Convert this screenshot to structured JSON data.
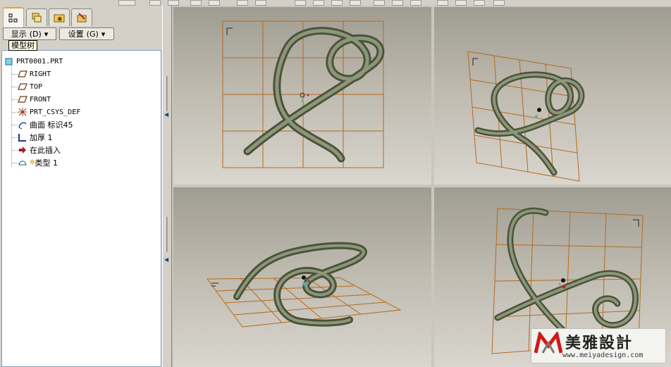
{
  "toolbar": {
    "show_label": "显示",
    "show_key": "(D)",
    "settings_label": "设置",
    "settings_key": "(G)"
  },
  "tooltip": "模型树",
  "tabs": [
    {
      "icon": "model-tree-tab-icon",
      "active": true
    },
    {
      "icon": "layers-tab-icon",
      "active": false
    },
    {
      "icon": "folder-browser-tab-icon",
      "active": false
    },
    {
      "icon": "favorites-tab-icon",
      "active": false
    }
  ],
  "tree": {
    "root": "PRT0001.PRT",
    "items": [
      {
        "label": "RIGHT",
        "icon": "datum-plane-icon"
      },
      {
        "label": "TOP",
        "icon": "datum-plane-icon"
      },
      {
        "label": "FRONT",
        "icon": "datum-plane-icon"
      },
      {
        "label": "PRT_CSYS_DEF",
        "icon": "csys-icon"
      },
      {
        "label": "曲面 标识45",
        "icon": "surface-icon"
      },
      {
        "label": "加厚 1",
        "icon": "thicken-icon"
      },
      {
        "label": "在此插入",
        "icon": "insert-here-arrow-icon"
      },
      {
        "label": "类型 1",
        "icon": "type-feature-icon"
      }
    ]
  },
  "watermark": {
    "text": "美雅設計",
    "url": "www.meiyadesign.com"
  },
  "colors": {
    "grid": "#b56a1e",
    "tube": "#5f6a4d",
    "tree_border": "#7f9db9",
    "active_tab": "#e6a43a"
  }
}
